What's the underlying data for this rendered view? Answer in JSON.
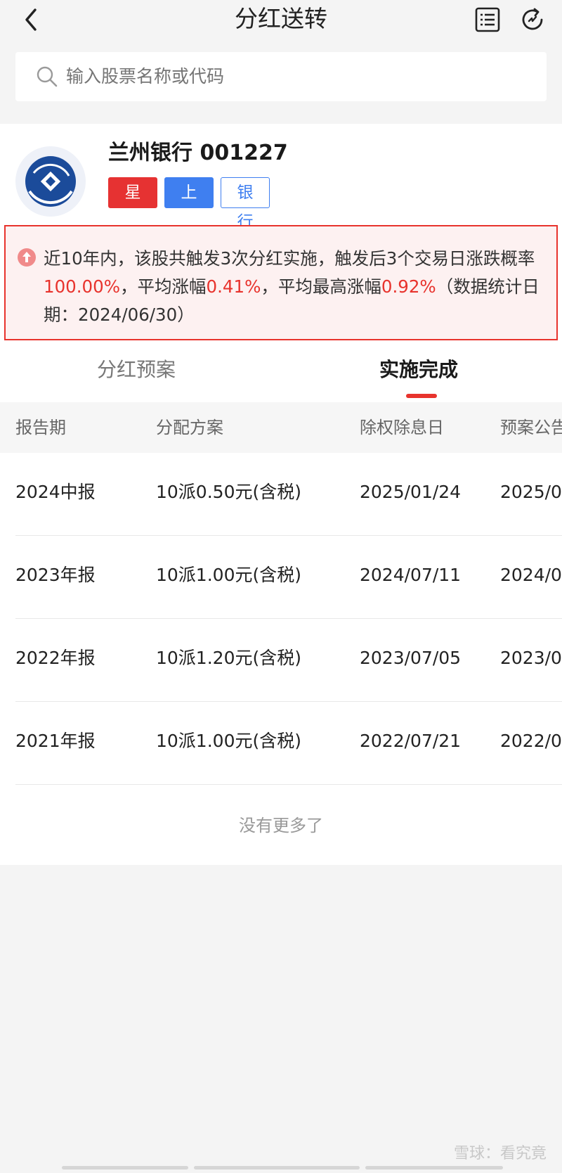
{
  "header": {
    "title": "分红送转",
    "back_icon": "chevron-left-icon",
    "list_icon": "list-icon",
    "refresh_icon": "refresh-icon"
  },
  "search": {
    "placeholder": "输入股票名称或代码"
  },
  "stock": {
    "name": "兰州银行 001227",
    "tags": [
      "星标",
      "上市",
      "银行"
    ]
  },
  "alert": {
    "t1": "近10年内，该股共触发3次分红实施，触发后3个交易日涨跌概率",
    "v1": "100.00%",
    "t2": "，平均涨幅",
    "v2": "0.41%",
    "t3": "，平均最高涨幅",
    "v3": "0.92%",
    "t4": "（数据统计日期：2024/06/30）"
  },
  "tabs": [
    "分红预案",
    "实施完成"
  ],
  "table": {
    "headers": [
      "报告期",
      "分配方案",
      "除权除息日",
      "预案公告日"
    ],
    "rows": [
      [
        "2024中报",
        "10派0.50元(含税)",
        "2025/01/24",
        "2025/0"
      ],
      [
        "2023年报",
        "10派1.00元(含税)",
        "2024/07/11",
        "2024/0"
      ],
      [
        "2022年报",
        "10派1.20元(含税)",
        "2023/07/05",
        "2023/0"
      ],
      [
        "2021年报",
        "10派1.00元(含税)",
        "2022/07/21",
        "2022/0"
      ]
    ]
  },
  "no_more": "没有更多了",
  "watermark": "雪球：看究竟",
  "colors": {
    "accent_red": "#e8332d",
    "tag_blue": "#3f7ff0"
  }
}
